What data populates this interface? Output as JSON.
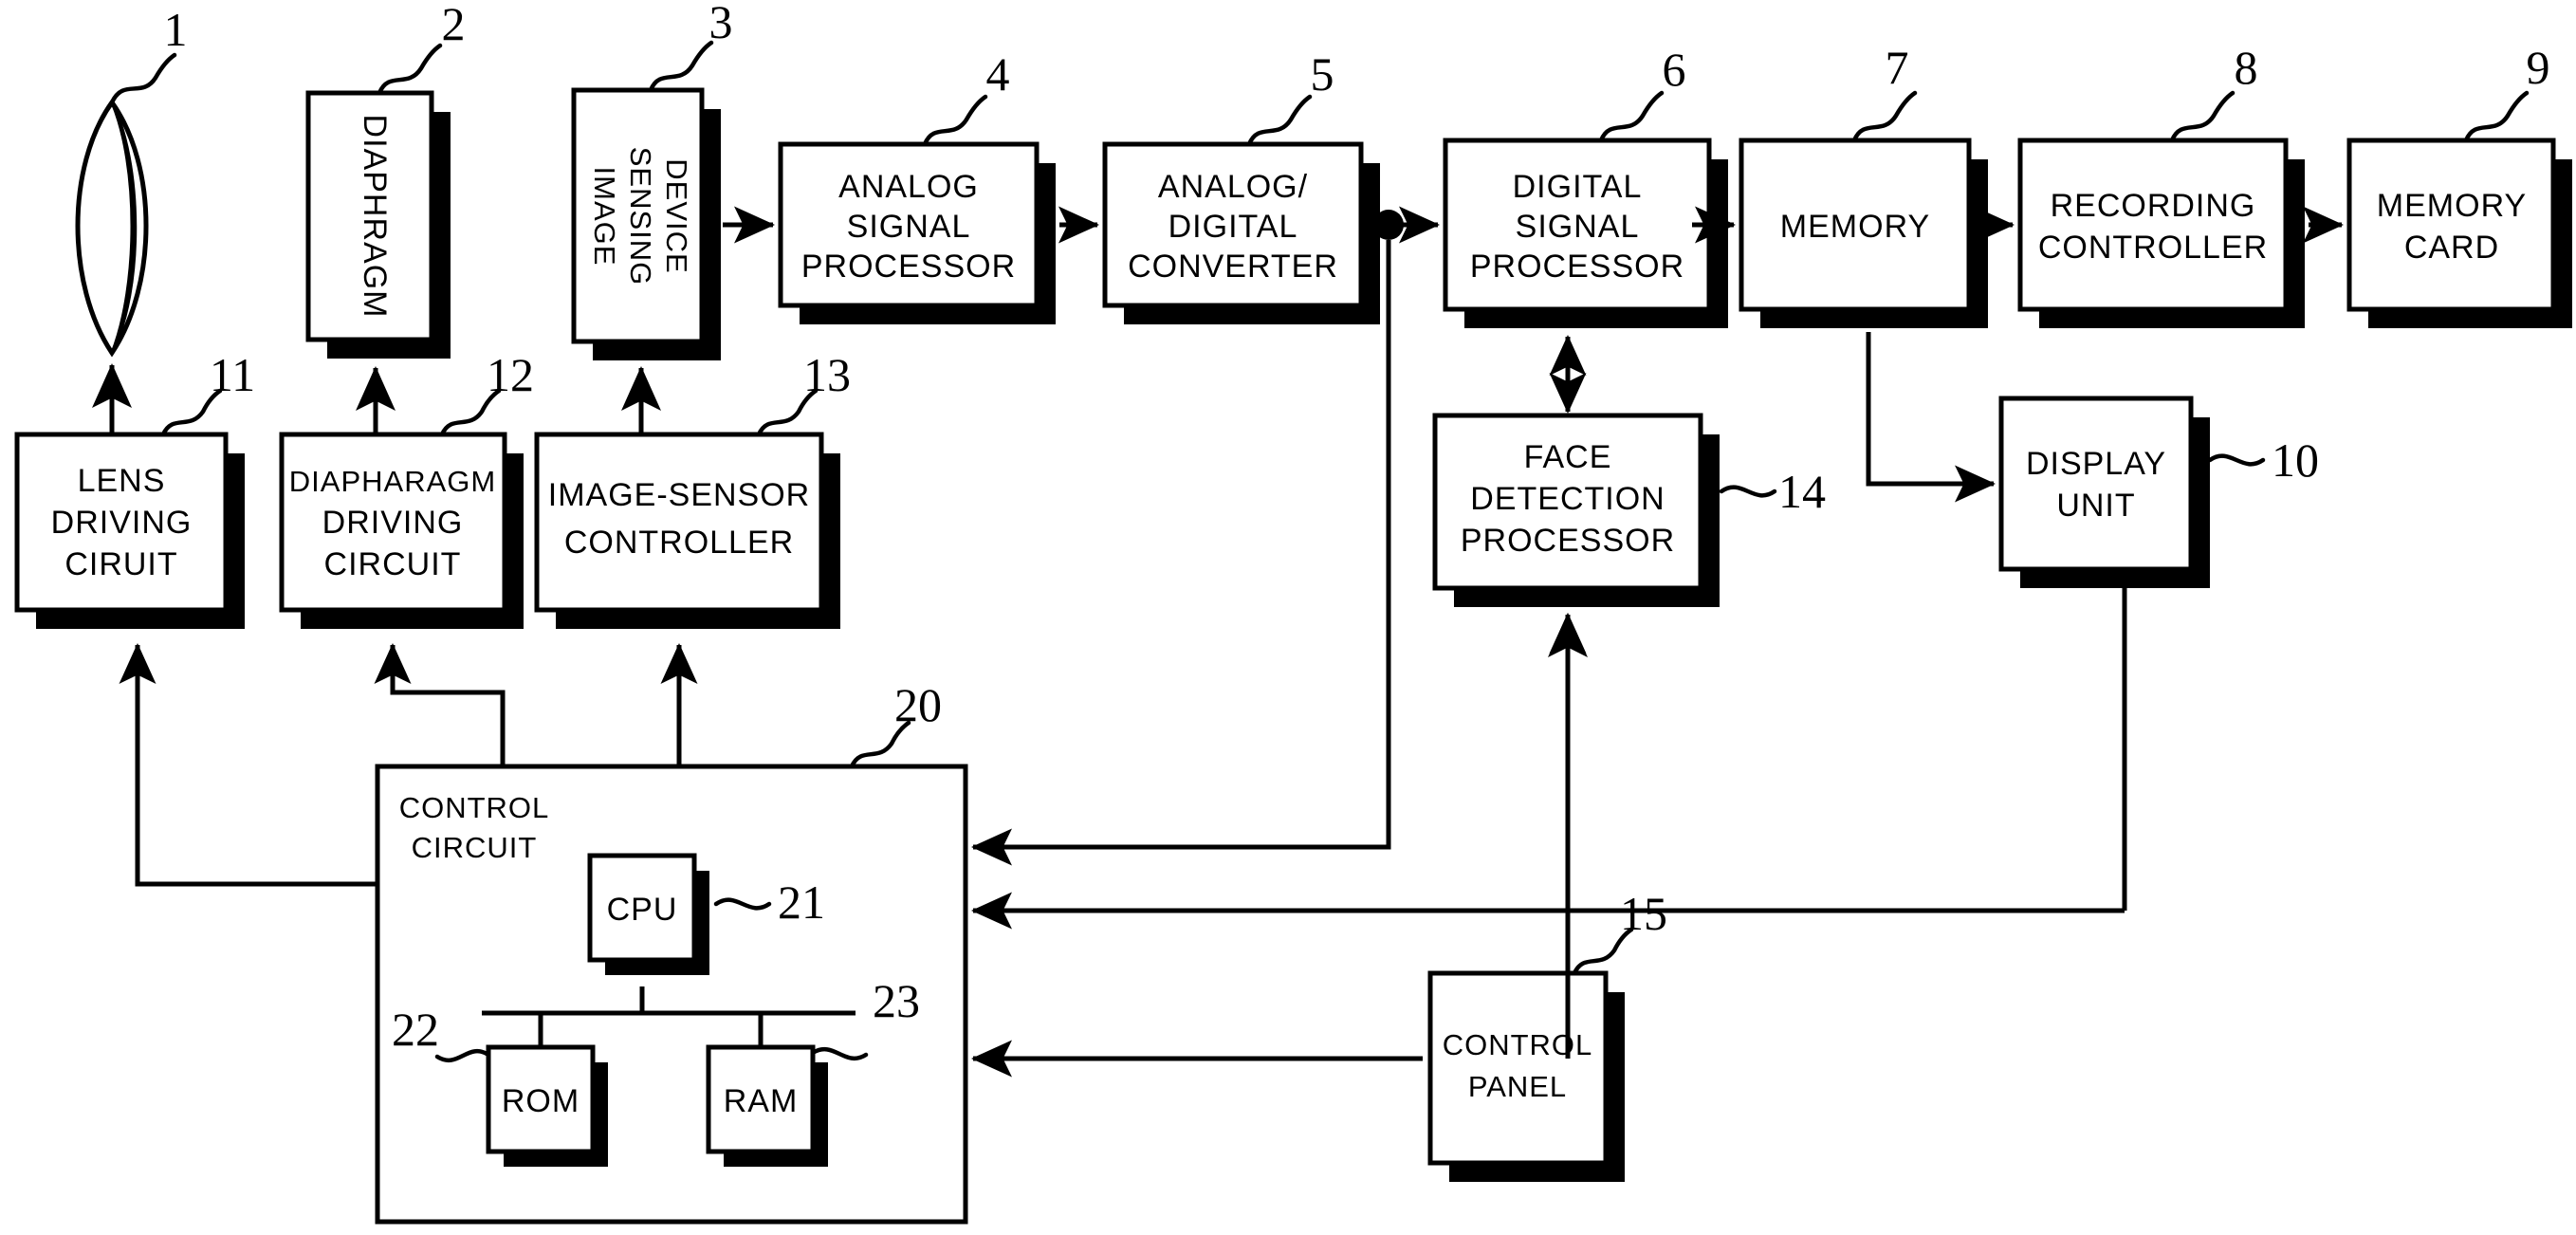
{
  "figure": {
    "title": "Digital camera block diagram",
    "style": "patent-line-drawing"
  },
  "blocks": [
    {
      "id": "lens",
      "ref": "1",
      "lines": [],
      "shape": "lens"
    },
    {
      "id": "diaphragm",
      "ref": "2",
      "lines": [
        "DIAPHRAGM"
      ],
      "shape": "box-vertical"
    },
    {
      "id": "image-sensing",
      "ref": "3",
      "lines": [
        "IMAGE",
        "SENSING",
        "DEVICE"
      ],
      "shape": "box-vertical"
    },
    {
      "id": "analog-signal",
      "ref": "4",
      "lines": [
        "ANALOG",
        "SIGNAL",
        "PROCESSOR"
      ],
      "shape": "box"
    },
    {
      "id": "ad-converter",
      "ref": "5",
      "lines": [
        "ANALOG/",
        "DIGITAL",
        "CONVERTER"
      ],
      "shape": "box"
    },
    {
      "id": "digital-signal",
      "ref": "6",
      "lines": [
        "DIGITAL",
        "SIGNAL",
        "PROCESSOR"
      ],
      "shape": "box"
    },
    {
      "id": "memory",
      "ref": "7",
      "lines": [
        "MEMORY"
      ],
      "shape": "box"
    },
    {
      "id": "recording-ctrl",
      "ref": "8",
      "lines": [
        "RECORDING",
        "CONTROLLER"
      ],
      "shape": "box"
    },
    {
      "id": "memory-card",
      "ref": "9",
      "lines": [
        "MEMORY",
        "CARD"
      ],
      "shape": "box"
    },
    {
      "id": "display-unit",
      "ref": "10",
      "lines": [
        "DISPLAY",
        "UNIT"
      ],
      "shape": "box"
    },
    {
      "id": "lens-driving",
      "ref": "11",
      "lines": [
        "LENS",
        "DRIVING",
        "CIRUIT"
      ],
      "shape": "box"
    },
    {
      "id": "diaph-driving",
      "ref": "12",
      "lines": [
        "DIAPHARAGM",
        "DRIVING",
        "CIRCUIT"
      ],
      "shape": "box"
    },
    {
      "id": "sensor-ctrl",
      "ref": "13",
      "lines": [
        "IMAGE-SENSOR",
        "CONTROLLER"
      ],
      "shape": "box"
    },
    {
      "id": "face-detection",
      "ref": "14",
      "lines": [
        "FACE",
        "DETECTION",
        "PROCESSOR"
      ],
      "shape": "box"
    },
    {
      "id": "control-panel",
      "ref": "15",
      "lines": [
        "CONTROL",
        "PANEL"
      ],
      "shape": "box"
    },
    {
      "id": "control-circuit",
      "ref": "20",
      "lines": [
        "CONTROL",
        "CIRCUIT"
      ],
      "shape": "container"
    },
    {
      "id": "cpu",
      "ref": "21",
      "lines": [
        "CPU"
      ],
      "shape": "box"
    },
    {
      "id": "rom",
      "ref": "22",
      "lines": [
        "ROM"
      ],
      "shape": "box"
    },
    {
      "id": "ram",
      "ref": "23",
      "lines": [
        "RAM"
      ],
      "shape": "box"
    }
  ],
  "labels": {
    "lens": "",
    "diaphragm": "DIAPHRAGM",
    "image_sensing_device": "IMAGE SENSING DEVICE",
    "analog_signal_processor": "ANALOG SIGNAL PROCESSOR",
    "ad_converter": "ANALOG/ DIGITAL CONVERTER",
    "digital_signal_processor": "DIGITAL SIGNAL PROCESSOR",
    "memory": "MEMORY",
    "recording_controller": "RECORDING CONTROLLER",
    "memory_card": "MEMORY CARD",
    "display_unit": "DISPLAY UNIT",
    "lens_driving_circuit": "LENS DRIVING CIRUIT",
    "diaphragm_driving_circuit": "DIAPHARAGM DRIVING CIRCUIT",
    "image_sensor_controller": "IMAGE-SENSOR CONTROLLER",
    "face_detection_processor": "FACE DETECTION PROCESSOR",
    "control_panel": "CONTROL PANEL",
    "control_circuit": "CONTROL CIRCUIT",
    "cpu": "CPU",
    "rom": "ROM",
    "ram": "RAM"
  },
  "text": {
    "diaphragm": "DIAPHRAGM",
    "img_l1": "IMAGE",
    "img_l2": "SENSING",
    "img_l3": "DEVICE",
    "asp_l1": "ANALOG",
    "asp_l2": "SIGNAL",
    "asp_l3": "PROCESSOR",
    "adc_l1": "ANALOG/",
    "adc_l2": "DIGITAL",
    "adc_l3": "CONVERTER",
    "dsp_l1": "DIGITAL",
    "dsp_l2": "SIGNAL",
    "dsp_l3": "PROCESSOR",
    "mem_l1": "MEMORY",
    "rec_l1": "RECORDING",
    "rec_l2": "CONTROLLER",
    "card_l1": "MEMORY",
    "card_l2": "CARD",
    "disp_l1": "DISPLAY",
    "disp_l2": "UNIT",
    "lensdrv_l1": "LENS",
    "lensdrv_l2": "DRIVING",
    "lensdrv_l3": "CIRUIT",
    "diadrv_l1": "DIAPHARAGM",
    "diadrv_l2": "DRIVING",
    "diadrv_l3": "CIRCUIT",
    "sensctl_l1": "IMAGE-SENSOR",
    "sensctl_l2": "CONTROLLER",
    "face_l1": "FACE",
    "face_l2": "DETECTION",
    "face_l3": "PROCESSOR",
    "panel_l1": "CONTROL",
    "panel_l2": "PANEL",
    "ctrl_l1": "CONTROL",
    "ctrl_l2": "CIRCUIT",
    "cpu": "CPU",
    "rom": "ROM",
    "ram": "RAM"
  },
  "refs": {
    "n1": "1",
    "n2": "2",
    "n3": "3",
    "n4": "4",
    "n5": "5",
    "n6": "6",
    "n7": "7",
    "n8": "8",
    "n9": "9",
    "n10": "10",
    "n11": "11",
    "n12": "12",
    "n13": "13",
    "n14": "14",
    "n15": "15",
    "n20": "20",
    "n21": "21",
    "n22": "22",
    "n23": "23"
  },
  "colors": {
    "ink": "#000000",
    "paper": "#ffffff"
  },
  "connections": [
    {
      "from": "lens",
      "to": "diaphragm",
      "type": "optical-implicit"
    },
    {
      "from": "image-sensing",
      "to": "analog-signal",
      "type": "arrow-right"
    },
    {
      "from": "analog-signal",
      "to": "ad-converter",
      "type": "arrow-right"
    },
    {
      "from": "ad-converter",
      "to": "digital-signal",
      "type": "arrow-right-with-junction"
    },
    {
      "from": "digital-signal",
      "to": "memory",
      "type": "arrow-right"
    },
    {
      "from": "memory",
      "to": "recording-ctrl",
      "type": "arrow-right"
    },
    {
      "from": "recording-ctrl",
      "to": "memory-card",
      "type": "arrow-right"
    },
    {
      "from": "memory",
      "to": "display-unit",
      "type": "elbow-arrow"
    },
    {
      "from": "digital-signal",
      "to": "face-detection",
      "type": "double-arrow-vertical"
    },
    {
      "from": "lens-driving",
      "to": "lens",
      "type": "arrow-up"
    },
    {
      "from": "diaph-driving",
      "to": "diaphragm",
      "type": "arrow-up"
    },
    {
      "from": "sensor-ctrl",
      "to": "image-sensing",
      "type": "arrow-up"
    },
    {
      "from": "control-circuit",
      "to": "lens-driving",
      "type": "elbow-arrow-up"
    },
    {
      "from": "control-circuit",
      "to": "diaph-driving",
      "type": "elbow-arrow-up"
    },
    {
      "from": "control-circuit",
      "to": "sensor-ctrl",
      "type": "arrow-up"
    },
    {
      "from": "control-circuit",
      "to": "face-detection",
      "type": "elbow-arrow-up"
    },
    {
      "from": "ad-converter",
      "to": "control-circuit",
      "type": "elbow-arrow-left"
    },
    {
      "from": "face-detection",
      "to": "control-circuit",
      "type": "elbow-arrow-left"
    },
    {
      "from": "control-panel",
      "to": "control-circuit",
      "type": "arrow-left"
    },
    {
      "from": "cpu",
      "to": "rom",
      "type": "bus"
    },
    {
      "from": "cpu",
      "to": "ram",
      "type": "bus"
    }
  ]
}
